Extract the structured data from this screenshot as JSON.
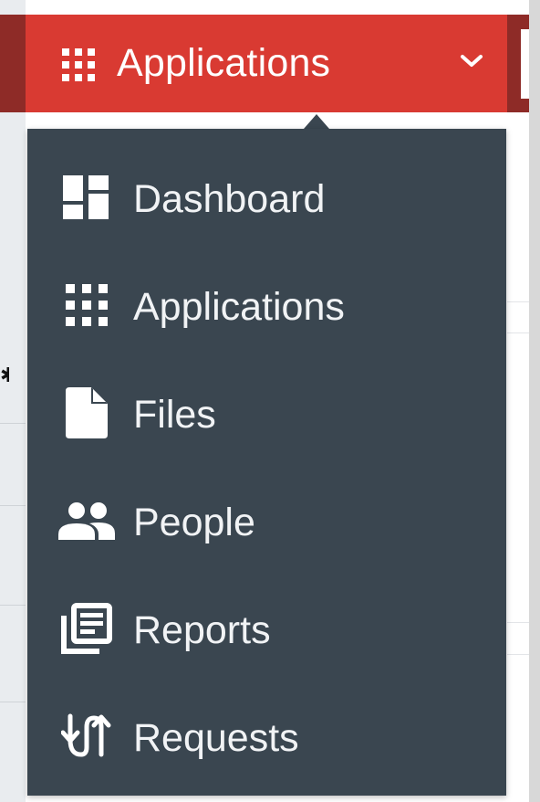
{
  "header": {
    "title": "Applications",
    "icon": "grid-icon",
    "toggle_icon": "chevron-down-icon",
    "color": "#d93a32"
  },
  "menu": {
    "background": "#3a4650",
    "items": [
      {
        "label": "Dashboard",
        "icon": "dashboard-icon"
      },
      {
        "label": "Applications",
        "icon": "grid-icon"
      },
      {
        "label": "Files",
        "icon": "file-icon"
      },
      {
        "label": "People",
        "icon": "people-icon"
      },
      {
        "label": "Reports",
        "icon": "reports-icon"
      },
      {
        "label": "Requests",
        "icon": "requests-icon"
      }
    ]
  }
}
